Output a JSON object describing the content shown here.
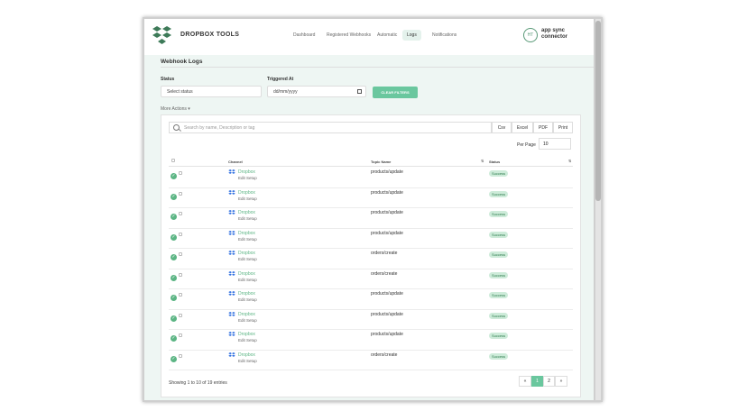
{
  "brand": "DROPBOX TOOLS",
  "nav": [
    "Dashboard",
    "Registered Webhooks",
    "Automatic",
    "Logs",
    "Notifications"
  ],
  "active_nav": "Logs",
  "account": {
    "initials": "HT",
    "name": "app sync connector"
  },
  "page_title": "Webhook Logs",
  "filters": {
    "status_label": "Status",
    "status_value": "Select status",
    "triggered_label": "Triggered At",
    "date_placeholder": "dd/mm/yyyy",
    "clear_label": "CLEAR FILTERS"
  },
  "more_actions": "More Actions ▾",
  "search_placeholder": "Search by name, Description or tag",
  "exports": [
    "Csv",
    "Excel",
    "PDF",
    "Print"
  ],
  "per_page_label": "Per Page",
  "per_page_value": "10",
  "columns": {
    "channel": "Channel",
    "topic": "Topic Name",
    "status": "Status"
  },
  "rows": [
    {
      "channel": "Dropbox",
      "sub": "Edit Setup",
      "topic": "products/update",
      "status": "Success"
    },
    {
      "channel": "Dropbox",
      "sub": "Edit Setup",
      "topic": "products/update",
      "status": "Success"
    },
    {
      "channel": "Dropbox",
      "sub": "Edit Setup",
      "topic": "products/update",
      "status": "Success"
    },
    {
      "channel": "Dropbox",
      "sub": "Edit Setup",
      "topic": "products/update",
      "status": "Success"
    },
    {
      "channel": "Dropbox",
      "sub": "Edit Setup",
      "topic": "orders/create",
      "status": "Success"
    },
    {
      "channel": "Dropbox",
      "sub": "Edit Setup",
      "topic": "orders/create",
      "status": "Success"
    },
    {
      "channel": "Dropbox",
      "sub": "Edit Setup",
      "topic": "products/update",
      "status": "Success"
    },
    {
      "channel": "Dropbox",
      "sub": "Edit Setup",
      "topic": "products/update",
      "status": "Success"
    },
    {
      "channel": "Dropbox",
      "sub": "Edit Setup",
      "topic": "products/update",
      "status": "Success"
    },
    {
      "channel": "Dropbox",
      "sub": "Edit Setup",
      "topic": "orders/create",
      "status": "Success"
    }
  ],
  "footer_text": "Showing 1 to 10 of 19 entries",
  "pagination": [
    "«",
    "1",
    "2",
    "»"
  ],
  "colors": {
    "accent": "#6ac79e",
    "badge_bg": "#cdebd9",
    "badge_text": "#2b7a4b"
  }
}
